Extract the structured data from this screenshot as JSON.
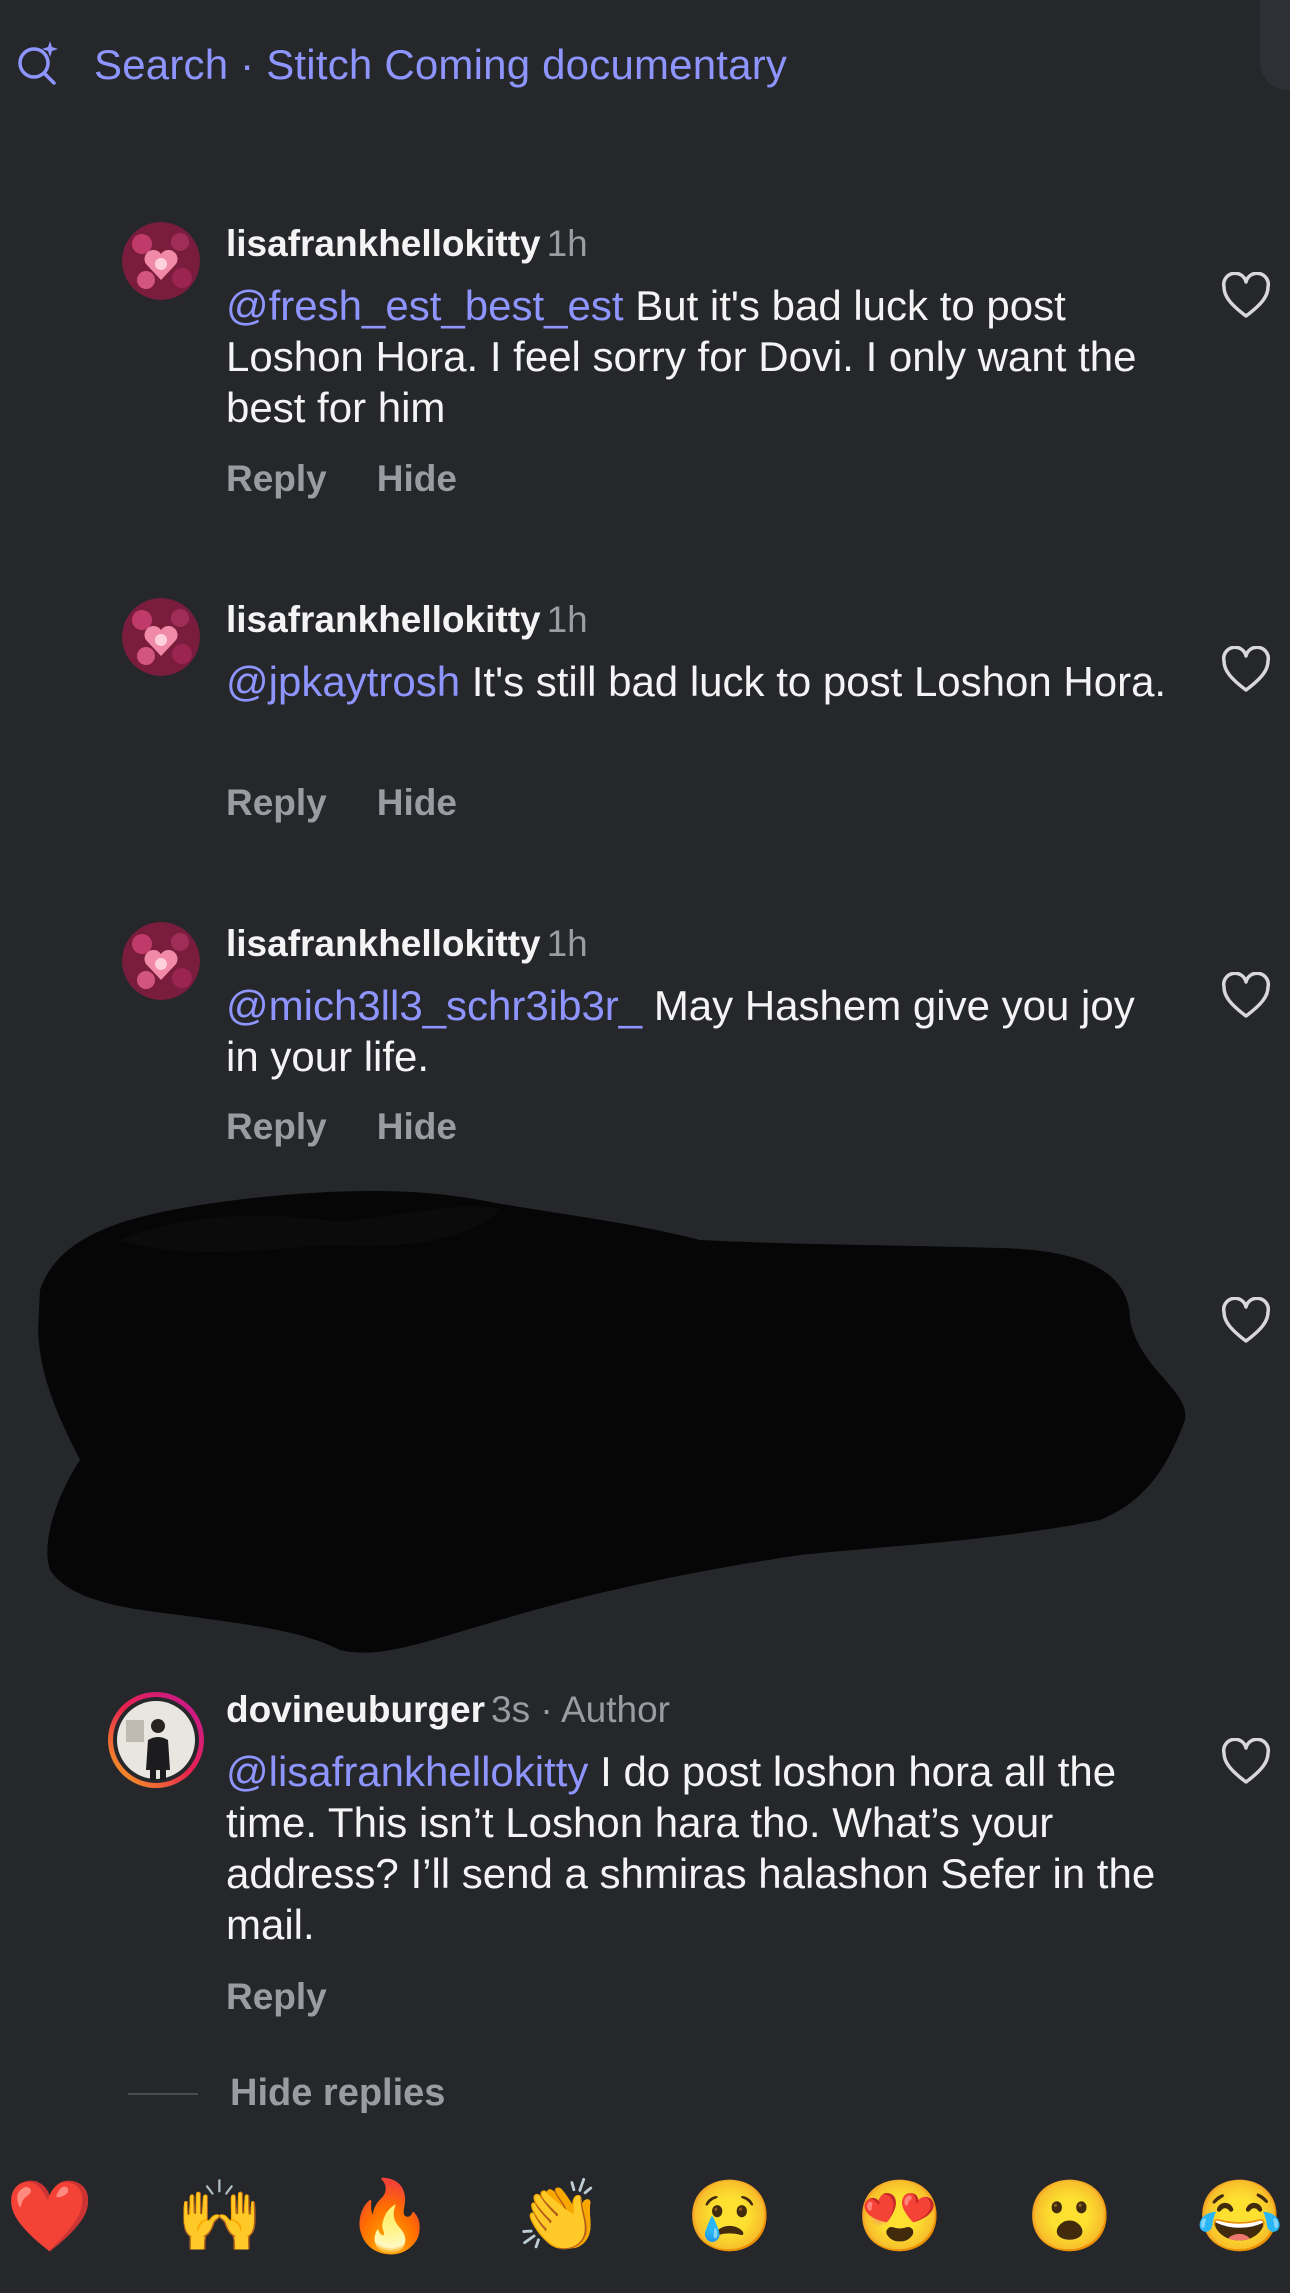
{
  "search": {
    "label": "Search",
    "separator": "·",
    "query": "Stitch Coming documentary"
  },
  "comments": [
    {
      "username": "lisafrankhellokitty",
      "time": "1h",
      "mention": "@fresh_est_best_est",
      "text": " But it's bad luck to post Loshon Hora. I feel sorry for Dovi. I only want the best for him",
      "reply": "Reply",
      "hide": "Hide"
    },
    {
      "username": "lisafrankhellokitty",
      "time": "1h",
      "mention": "@jpkaytrosh",
      "text": " It's still bad luck to post Loshon Hora.",
      "reply": "Reply",
      "hide": "Hide"
    },
    {
      "username": "lisafrankhellokitty",
      "time": "1h",
      "mention": "@mich3ll3_schr3ib3r_",
      "text": " May Hashem give you joy in your life.",
      "reply": "Reply",
      "hide": "Hide"
    },
    {
      "username": "dovineuburger",
      "time": "3s",
      "author_tag": " · Author",
      "mention": "@lisafrankhellokitty",
      "text": " I do post loshon hora all the time. This isn’t Loshon hara tho. What’s your address? I’ll send a shmiras halashon Sefer in the mail.",
      "reply": "Reply"
    }
  ],
  "hide_replies": "Hide replies",
  "reactions": [
    "❤️",
    "🙌",
    "🔥",
    "👏",
    "😢",
    "😍",
    "😮",
    "😂"
  ],
  "colors": {
    "background": "#25272b",
    "accent": "#8f95ff",
    "muted": "#9a9ca2"
  },
  "icons": {
    "search": "search-sparkle-icon",
    "like": "heart-outline-icon"
  }
}
